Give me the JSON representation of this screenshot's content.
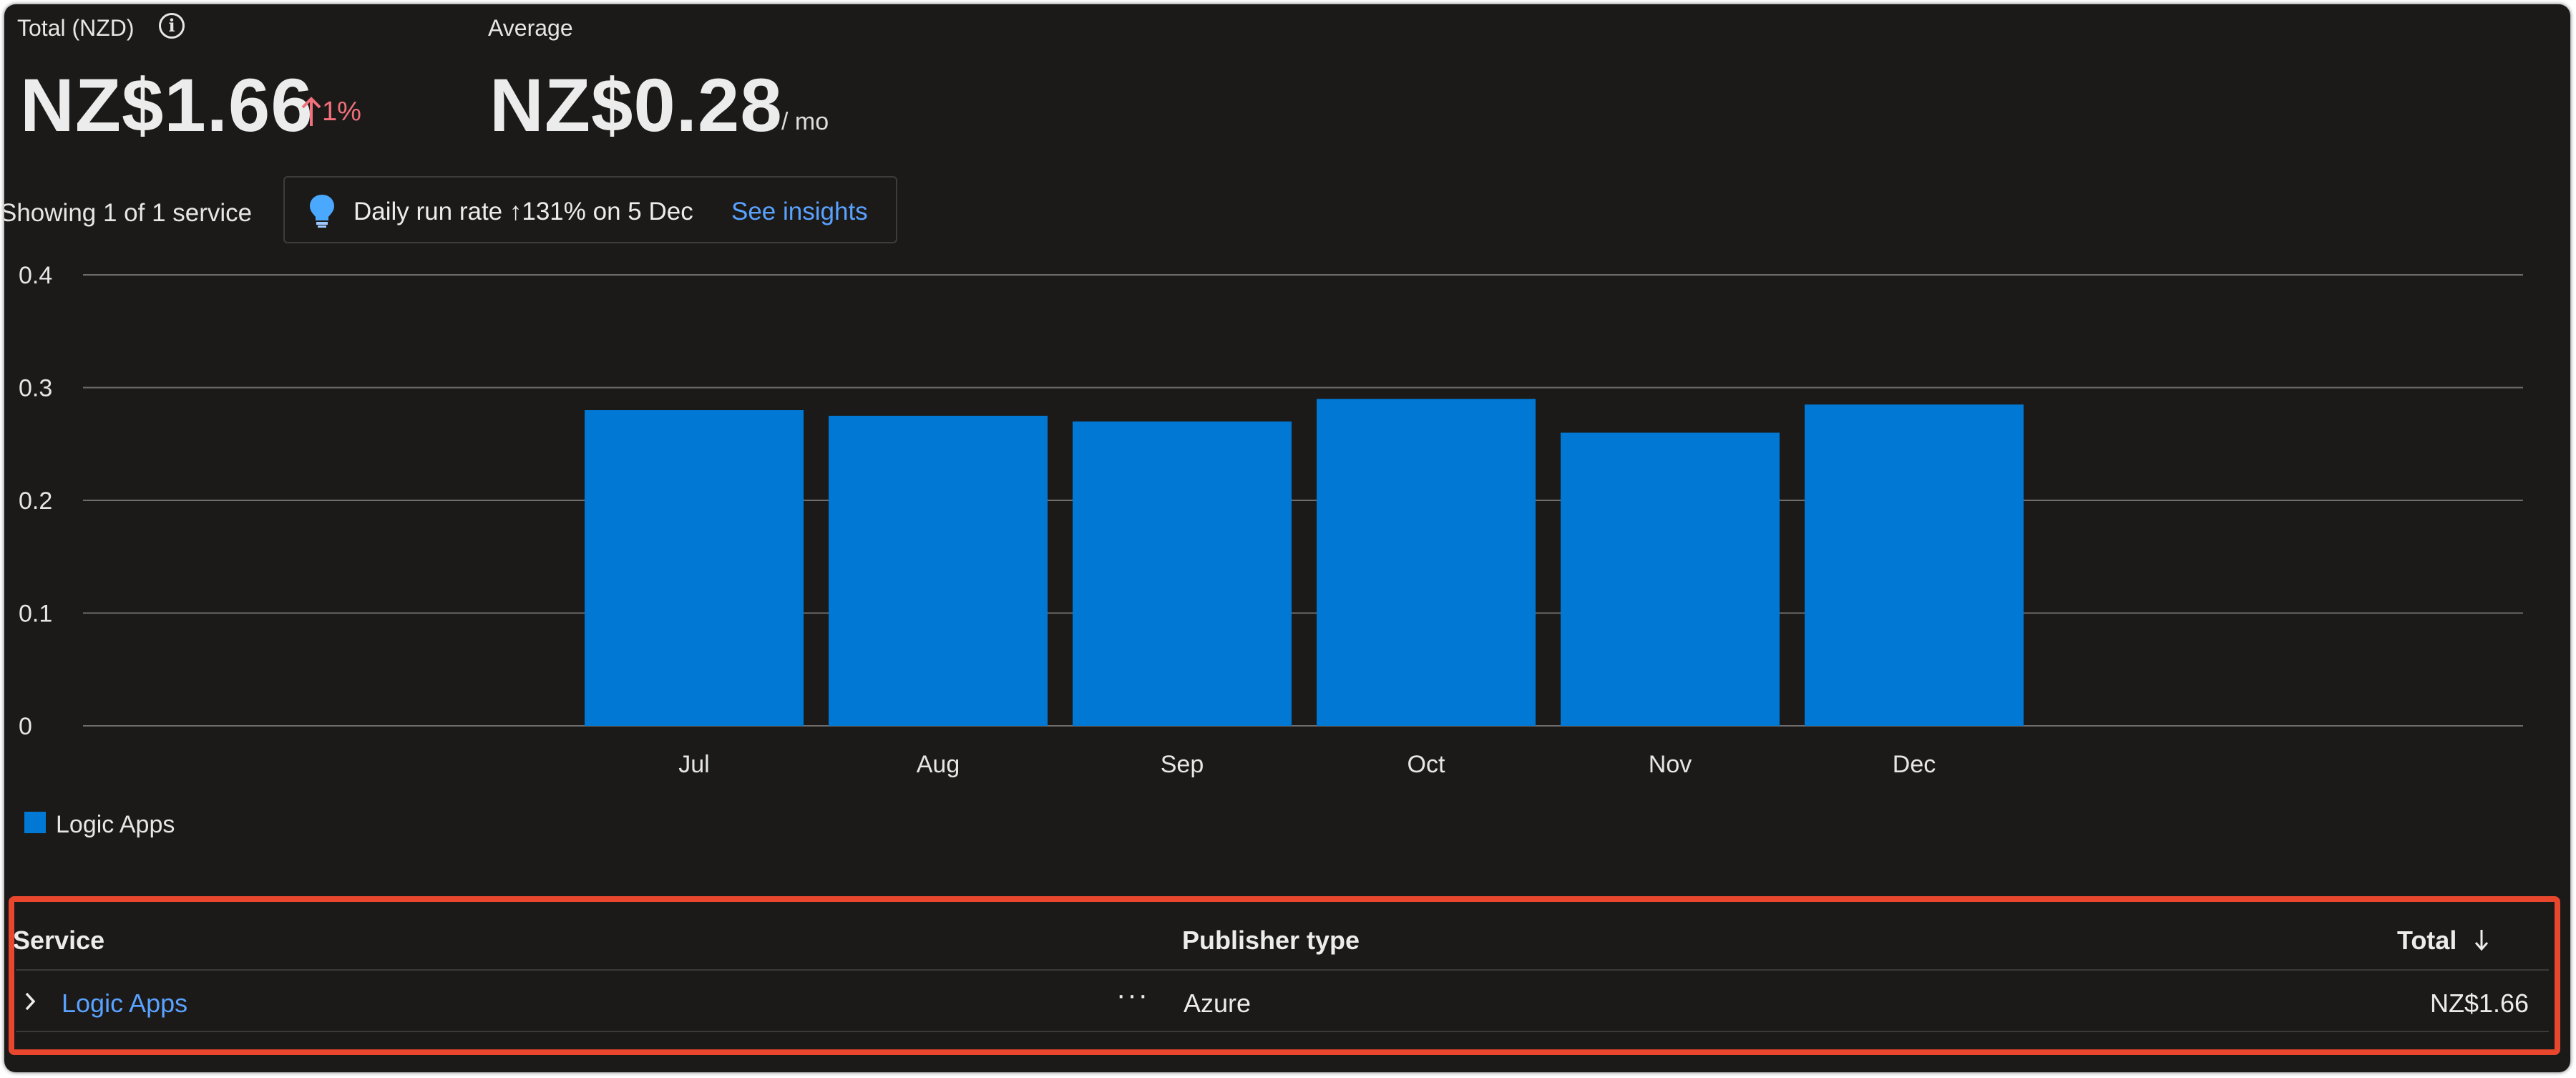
{
  "summary": {
    "total_label": "Total (NZD)",
    "total_value": "NZ$1.66",
    "total_trend": "1%",
    "average_label": "Average",
    "average_value": "NZ$0.28",
    "average_unit": "/ mo"
  },
  "filter_bar": {
    "showing_text": "Showing 1 of 1 service",
    "insight_text": "Daily run rate ↑131% on 5 Dec",
    "insight_link": "See insights"
  },
  "chart_data": {
    "type": "bar",
    "title": "",
    "xlabel": "",
    "ylabel": "",
    "categories": [
      "Jul",
      "Aug",
      "Sep",
      "Oct",
      "Nov",
      "Dec"
    ],
    "series": [
      {
        "name": "Logic Apps",
        "color": "#0078d4",
        "values": [
          0.28,
          0.275,
          0.27,
          0.29,
          0.26,
          0.285
        ]
      }
    ],
    "yticks": [
      0,
      0.1,
      0.2,
      0.3,
      0.4
    ],
    "ytick_labels": [
      "0",
      "0.1",
      "0.2",
      "0.3",
      "0.4"
    ],
    "ylim": [
      0,
      0.4
    ],
    "grid": true,
    "legend_placement": "bottom-left"
  },
  "table": {
    "headers": {
      "service": "Service",
      "publisher": "Publisher type",
      "total": "Total"
    },
    "rows": [
      {
        "service": "Logic Apps",
        "more": "···",
        "publisher": "Azure",
        "total": "NZ$1.66"
      }
    ]
  },
  "icons": {
    "info": "info-icon",
    "trend": "arrow-up-icon",
    "insight": "lightbulb-icon",
    "expand": "chevron-right-icon",
    "sort": "arrow-down-icon",
    "more": "more-options-icon"
  },
  "colors": {
    "background": "#1b1a19",
    "bar": "#0078d4",
    "link": "#5aa2ff",
    "trend_up": "#f1707b",
    "highlight_box": "#e8472e"
  }
}
